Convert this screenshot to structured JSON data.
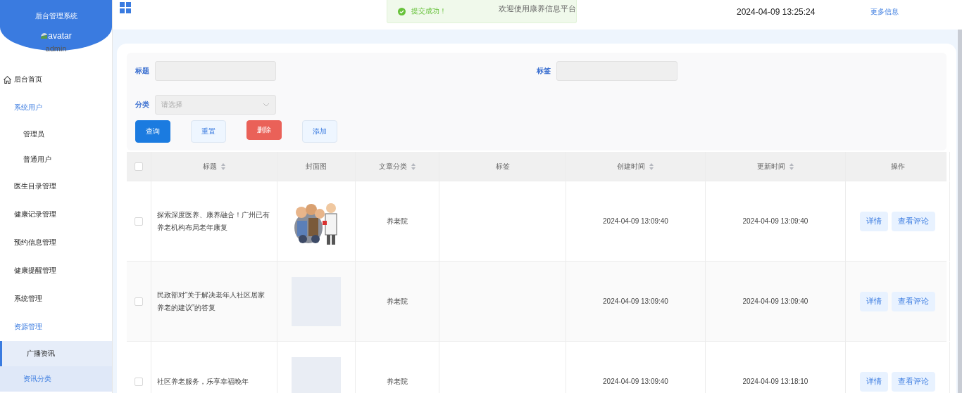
{
  "header": {
    "brand": "后台管理系统",
    "avatar_alt": "avatar",
    "username": "admin",
    "welcome": "欢迎使用康养信息平台",
    "datetime": "2024-04-09 13:25:24",
    "more_link": "更多信息"
  },
  "toast": {
    "kind": "success",
    "message": "提交成功！"
  },
  "sidebar": {
    "items": [
      {
        "label": "后台首页",
        "kind": "link",
        "icon": true,
        "selected": false
      },
      {
        "label": "系统用户",
        "kind": "group",
        "expanded": true,
        "children": [
          {
            "label": "管理员",
            "selected": false,
            "hovered": false
          },
          {
            "label": "普通用户",
            "selected": false,
            "hovered": false
          }
        ]
      },
      {
        "label": "医生目录管理",
        "kind": "link",
        "icon": false,
        "selected": false
      },
      {
        "label": "健康记录管理",
        "kind": "link",
        "icon": false,
        "selected": false
      },
      {
        "label": "预约信息管理",
        "kind": "link",
        "icon": false,
        "selected": false
      },
      {
        "label": "健康提醒管理",
        "kind": "link",
        "icon": false,
        "selected": false
      },
      {
        "label": "系统管理",
        "kind": "link",
        "icon": false,
        "selected": false
      },
      {
        "label": "资源管理",
        "kind": "group",
        "expanded": true,
        "children": [
          {
            "label": "广播资讯",
            "selected": true,
            "hovered": false
          },
          {
            "label": "资讯分类",
            "selected": false,
            "hovered": true
          }
        ]
      }
    ]
  },
  "filters": [
    {
      "label": "标题",
      "kind": "input"
    },
    {
      "label": "标签",
      "kind": "input"
    },
    {
      "label": "分类",
      "kind": "select",
      "placeholder": "请选择"
    }
  ],
  "buttons": [
    {
      "label": "查询",
      "kind": "primary"
    },
    {
      "label": "重置",
      "kind": "plain"
    },
    {
      "label": "删除",
      "kind": "danger"
    },
    {
      "label": "添加",
      "kind": "plain"
    }
  ],
  "table": {
    "all_selected": false,
    "columns": [
      {
        "label": "标题",
        "kind": "sortable"
      },
      {
        "label": "封面图",
        "kind": "plain"
      },
      {
        "label": "文章分类",
        "kind": "sortable"
      },
      {
        "label": "标签",
        "kind": "plain"
      },
      {
        "label": "创建时间",
        "kind": "sortable"
      },
      {
        "label": "更新时间",
        "kind": "sortable"
      },
      {
        "label": "操作",
        "kind": "plain"
      }
    ],
    "rows": [
      {
        "selected": false,
        "title": "探索深度医养、康养融合！广州已有养老机构布局老年康复",
        "cover": {
          "kind": "picture"
        },
        "category": "养老院",
        "created": "2024-04-09 13:09:40",
        "updated": "2024-04-09 13:09:40",
        "actions": [
          "详情",
          "查看评论"
        ]
      },
      {
        "selected": false,
        "title": "民政部对“关于解决老年人社区居家养老的建议”的答复",
        "cover": {
          "kind": "placeholder"
        },
        "category": "养老院",
        "created": "2024-04-09 13:09:40",
        "updated": "2024-04-09 13:09:40",
        "actions": [
          "详情",
          "查看评论"
        ]
      },
      {
        "selected": false,
        "title": "社区养老服务，乐享幸福晚年",
        "cover": {
          "kind": "placeholder"
        },
        "category": "养老院",
        "created": "2024-04-09 13:09:40",
        "updated": "2024-04-09 13:18:10",
        "actions": [
          "详情",
          "查看评论"
        ]
      }
    ]
  }
}
